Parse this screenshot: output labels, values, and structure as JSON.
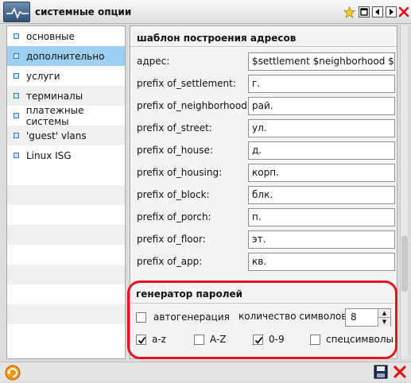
{
  "window": {
    "title": "системные опции"
  },
  "sidebar": {
    "items": [
      {
        "label": "основные"
      },
      {
        "label": "дополнительно"
      },
      {
        "label": "услуги"
      },
      {
        "label": "терминалы"
      },
      {
        "label": "платежные системы"
      },
      {
        "label": "'guest' vlans"
      },
      {
        "label": "Linux ISG"
      }
    ],
    "active_index": 1
  },
  "address_template": {
    "title": "шаблон построения адресов",
    "fields": [
      {
        "label": "адрес:",
        "value": "$settlement $neighborhood $lane"
      },
      {
        "label": "prefix of_settlement:",
        "value": "г."
      },
      {
        "label": "prefix of_neighborhood:",
        "value": "рай."
      },
      {
        "label": "prefix of_street:",
        "value": "ул."
      },
      {
        "label": "prefix of_house:",
        "value": "д."
      },
      {
        "label": "prefix of_housing:",
        "value": "корп."
      },
      {
        "label": "prefix of_block:",
        "value": "блк."
      },
      {
        "label": "prefix of_porch:",
        "value": "п."
      },
      {
        "label": "prefix of_floor:",
        "value": "эт."
      },
      {
        "label": "prefix of_app:",
        "value": "кв."
      }
    ]
  },
  "password_generator": {
    "title": "генератор паролей",
    "autogen_label": "автогенерация",
    "autogen_checked": false,
    "count_label": "количество символов:",
    "count_value": "8",
    "options": [
      {
        "label": "a-z",
        "checked": true
      },
      {
        "label": "A-Z",
        "checked": false
      },
      {
        "label": "0-9",
        "checked": true
      },
      {
        "label": "спецсимволы",
        "checked": false
      }
    ]
  },
  "colors": {
    "highlight": "#e3141c",
    "active_item": "#9ccff0"
  }
}
